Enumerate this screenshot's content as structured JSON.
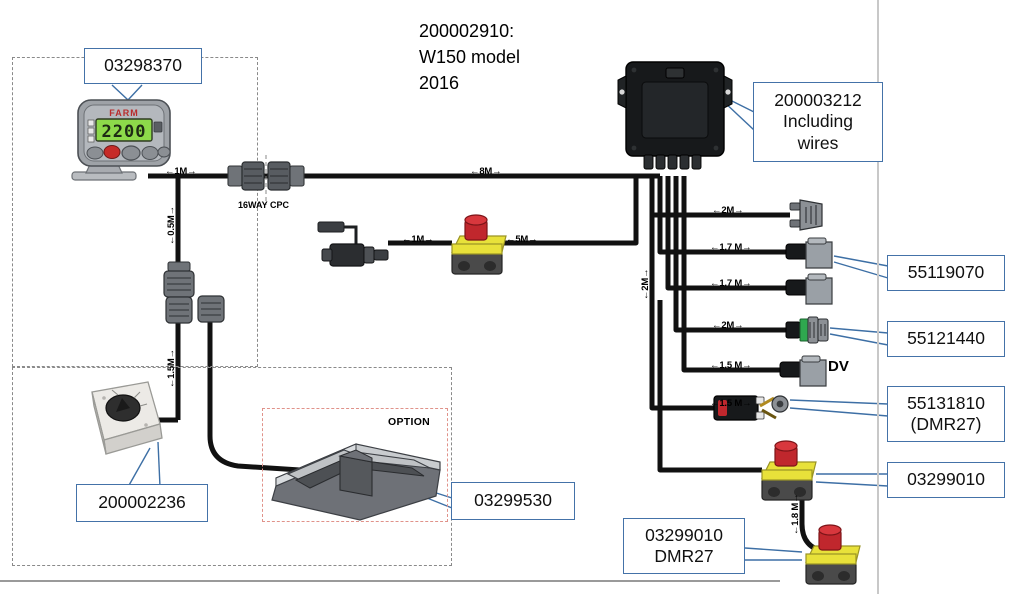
{
  "diagram": {
    "title_lines": [
      "200002910:",
      "W150  model",
      "2016"
    ]
  },
  "callouts": [
    {
      "id": "display-unit",
      "lines": [
        "03298370"
      ]
    },
    {
      "id": "control-box",
      "lines": [
        "200003212",
        "Including",
        "wires"
      ]
    },
    {
      "id": "connector-55119070",
      "lines": [
        "55119070"
      ]
    },
    {
      "id": "connector-55121440",
      "lines": [
        "55121440"
      ]
    },
    {
      "id": "limit-switch",
      "lines": [
        "55131810",
        "(DMR27)"
      ]
    },
    {
      "id": "estop-right",
      "lines": [
        "03299010"
      ]
    },
    {
      "id": "estop-bottom",
      "lines": [
        "03299010",
        "DMR27"
      ]
    },
    {
      "id": "selector-switch",
      "lines": [
        "200002236"
      ]
    },
    {
      "id": "foot-pedal",
      "lines": [
        "03299530"
      ]
    }
  ],
  "cable_lengths": {
    "display_to_cpc": "1M",
    "main_bus": "8M",
    "display_down": "0.5M",
    "selector_down": "1.5M",
    "solenoid_in": "1M",
    "estop_mid_out": "5M",
    "branch_1": "2M",
    "branch_2": "1.7 M",
    "branch_3": "1.7 M",
    "branch_4": "2M",
    "branch_5": "1.5 M",
    "limit_switch": "1.5 M",
    "estop_trunk": "2M",
    "estop_link": "1.8 M"
  },
  "annotations": {
    "cpc_connector": [
      "16WAY",
      "CPC"
    ],
    "dv_marker": "DV",
    "option_marker": "OPTION"
  },
  "display": {
    "brand": "FARM",
    "reading": "2200"
  },
  "colors": {
    "callout_border": "#4472a8",
    "cable": "#111111",
    "estop_body": "#e8e13a",
    "estop_button": "#c0272d",
    "display_lcd": "#8dd94a",
    "group_frame": "#8a8a8a",
    "option_frame": "#e0928a"
  }
}
